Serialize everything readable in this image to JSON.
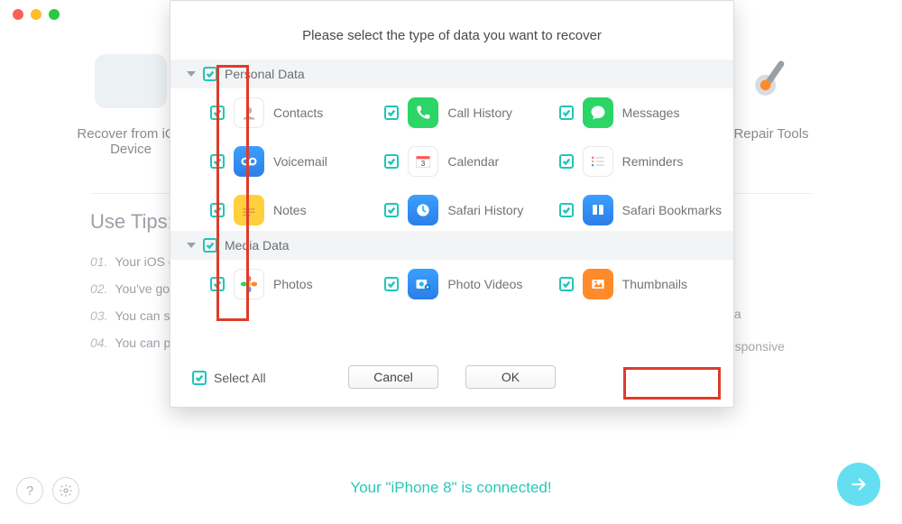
{
  "window": {
    "left_tile_label": "Recover from iOS Device",
    "right_tile_label": "Repair Tools"
  },
  "use_tips": {
    "heading": "Use Tips:",
    "steps": [
      "Your iOS device is connected.",
      "You've got iOS notifications. PhoneRescue detected your device has new data after deletion.",
      "You can select the items to scan.",
      "You can preview and select the items to recover."
    ]
  },
  "device_options": [
    "Accidentally deleted data",
    "Device is broken & unresponsive"
  ],
  "status_text": "Your \"iPhone 8\" is connected!",
  "modal": {
    "title": "Please select the type of data you want to recover",
    "sections": [
      {
        "title": "Personal Data",
        "items": [
          {
            "label": "Contacts",
            "icon": "contacts",
            "color": "bg-white"
          },
          {
            "label": "Call History",
            "icon": "phone",
            "color": "bg-green"
          },
          {
            "label": "Messages",
            "icon": "bubble",
            "color": "bg-green"
          },
          {
            "label": "Voicemail",
            "icon": "voicemail",
            "color": "bg-bluegrad"
          },
          {
            "label": "Calendar",
            "icon": "calendar",
            "color": "bg-white"
          },
          {
            "label": "Reminders",
            "icon": "lines",
            "color": "bg-white"
          },
          {
            "label": "Notes",
            "icon": "notes",
            "color": "bg-yellow"
          },
          {
            "label": "Safari History",
            "icon": "clock",
            "color": "bg-bluegrad"
          },
          {
            "label": "Safari Bookmarks",
            "icon": "book",
            "color": "bg-bluegrad"
          }
        ]
      },
      {
        "title": "Media Data",
        "items": [
          {
            "label": "Photos",
            "icon": "flower",
            "color": "bg-white"
          },
          {
            "label": "Photo Videos",
            "icon": "photovideo",
            "color": "bg-bluegrad"
          },
          {
            "label": "Thumbnails",
            "icon": "thumb",
            "color": "bg-orange"
          }
        ]
      }
    ],
    "select_all": "Select All",
    "cancel": "Cancel",
    "ok": "OK"
  }
}
